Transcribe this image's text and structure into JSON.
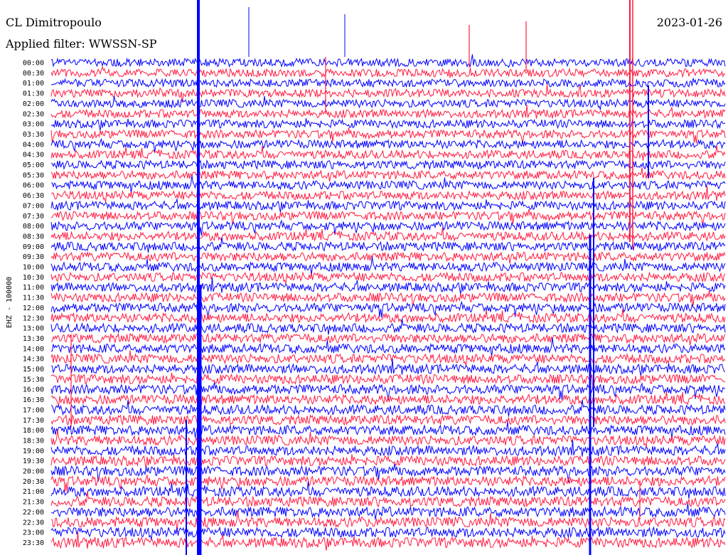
{
  "header": {
    "station": "CL Dimitropoulo",
    "date": "2023-01-26",
    "filter": "Applied filter: WWSSN-SP"
  },
  "colors": {
    "trace_a": "#0000ff",
    "trace_b": "#ff1a40",
    "background": "#ffffff",
    "text": "#000000"
  },
  "chart_data": {
    "type": "line",
    "ylabel": "EHZ - 100000",
    "row_labels": [
      "00:00",
      "00:30",
      "01:00",
      "01:30",
      "02:00",
      "02:30",
      "03:00",
      "03:30",
      "04:00",
      "04:30",
      "05:00",
      "05:30",
      "06:00",
      "06:30",
      "07:00",
      "07:30",
      "08:00",
      "08:30",
      "09:00",
      "09:30",
      "10:00",
      "10:30",
      "11:00",
      "11:30",
      "12:00",
      "12:30",
      "13:00",
      "13:30",
      "14:00",
      "14:30",
      "15:00",
      "15:30",
      "16:00",
      "16:30",
      "17:00",
      "17:30",
      "18:00",
      "18:30",
      "19:00",
      "19:30",
      "20:00",
      "20:30",
      "21:00",
      "21:30",
      "22:00",
      "22:30",
      "23:00",
      "23:30"
    ],
    "series_colors_alternating": [
      "#0000ff",
      "#ff1a40"
    ],
    "xlim_minutes": [
      0,
      30
    ],
    "grid": false,
    "legend": "none"
  }
}
